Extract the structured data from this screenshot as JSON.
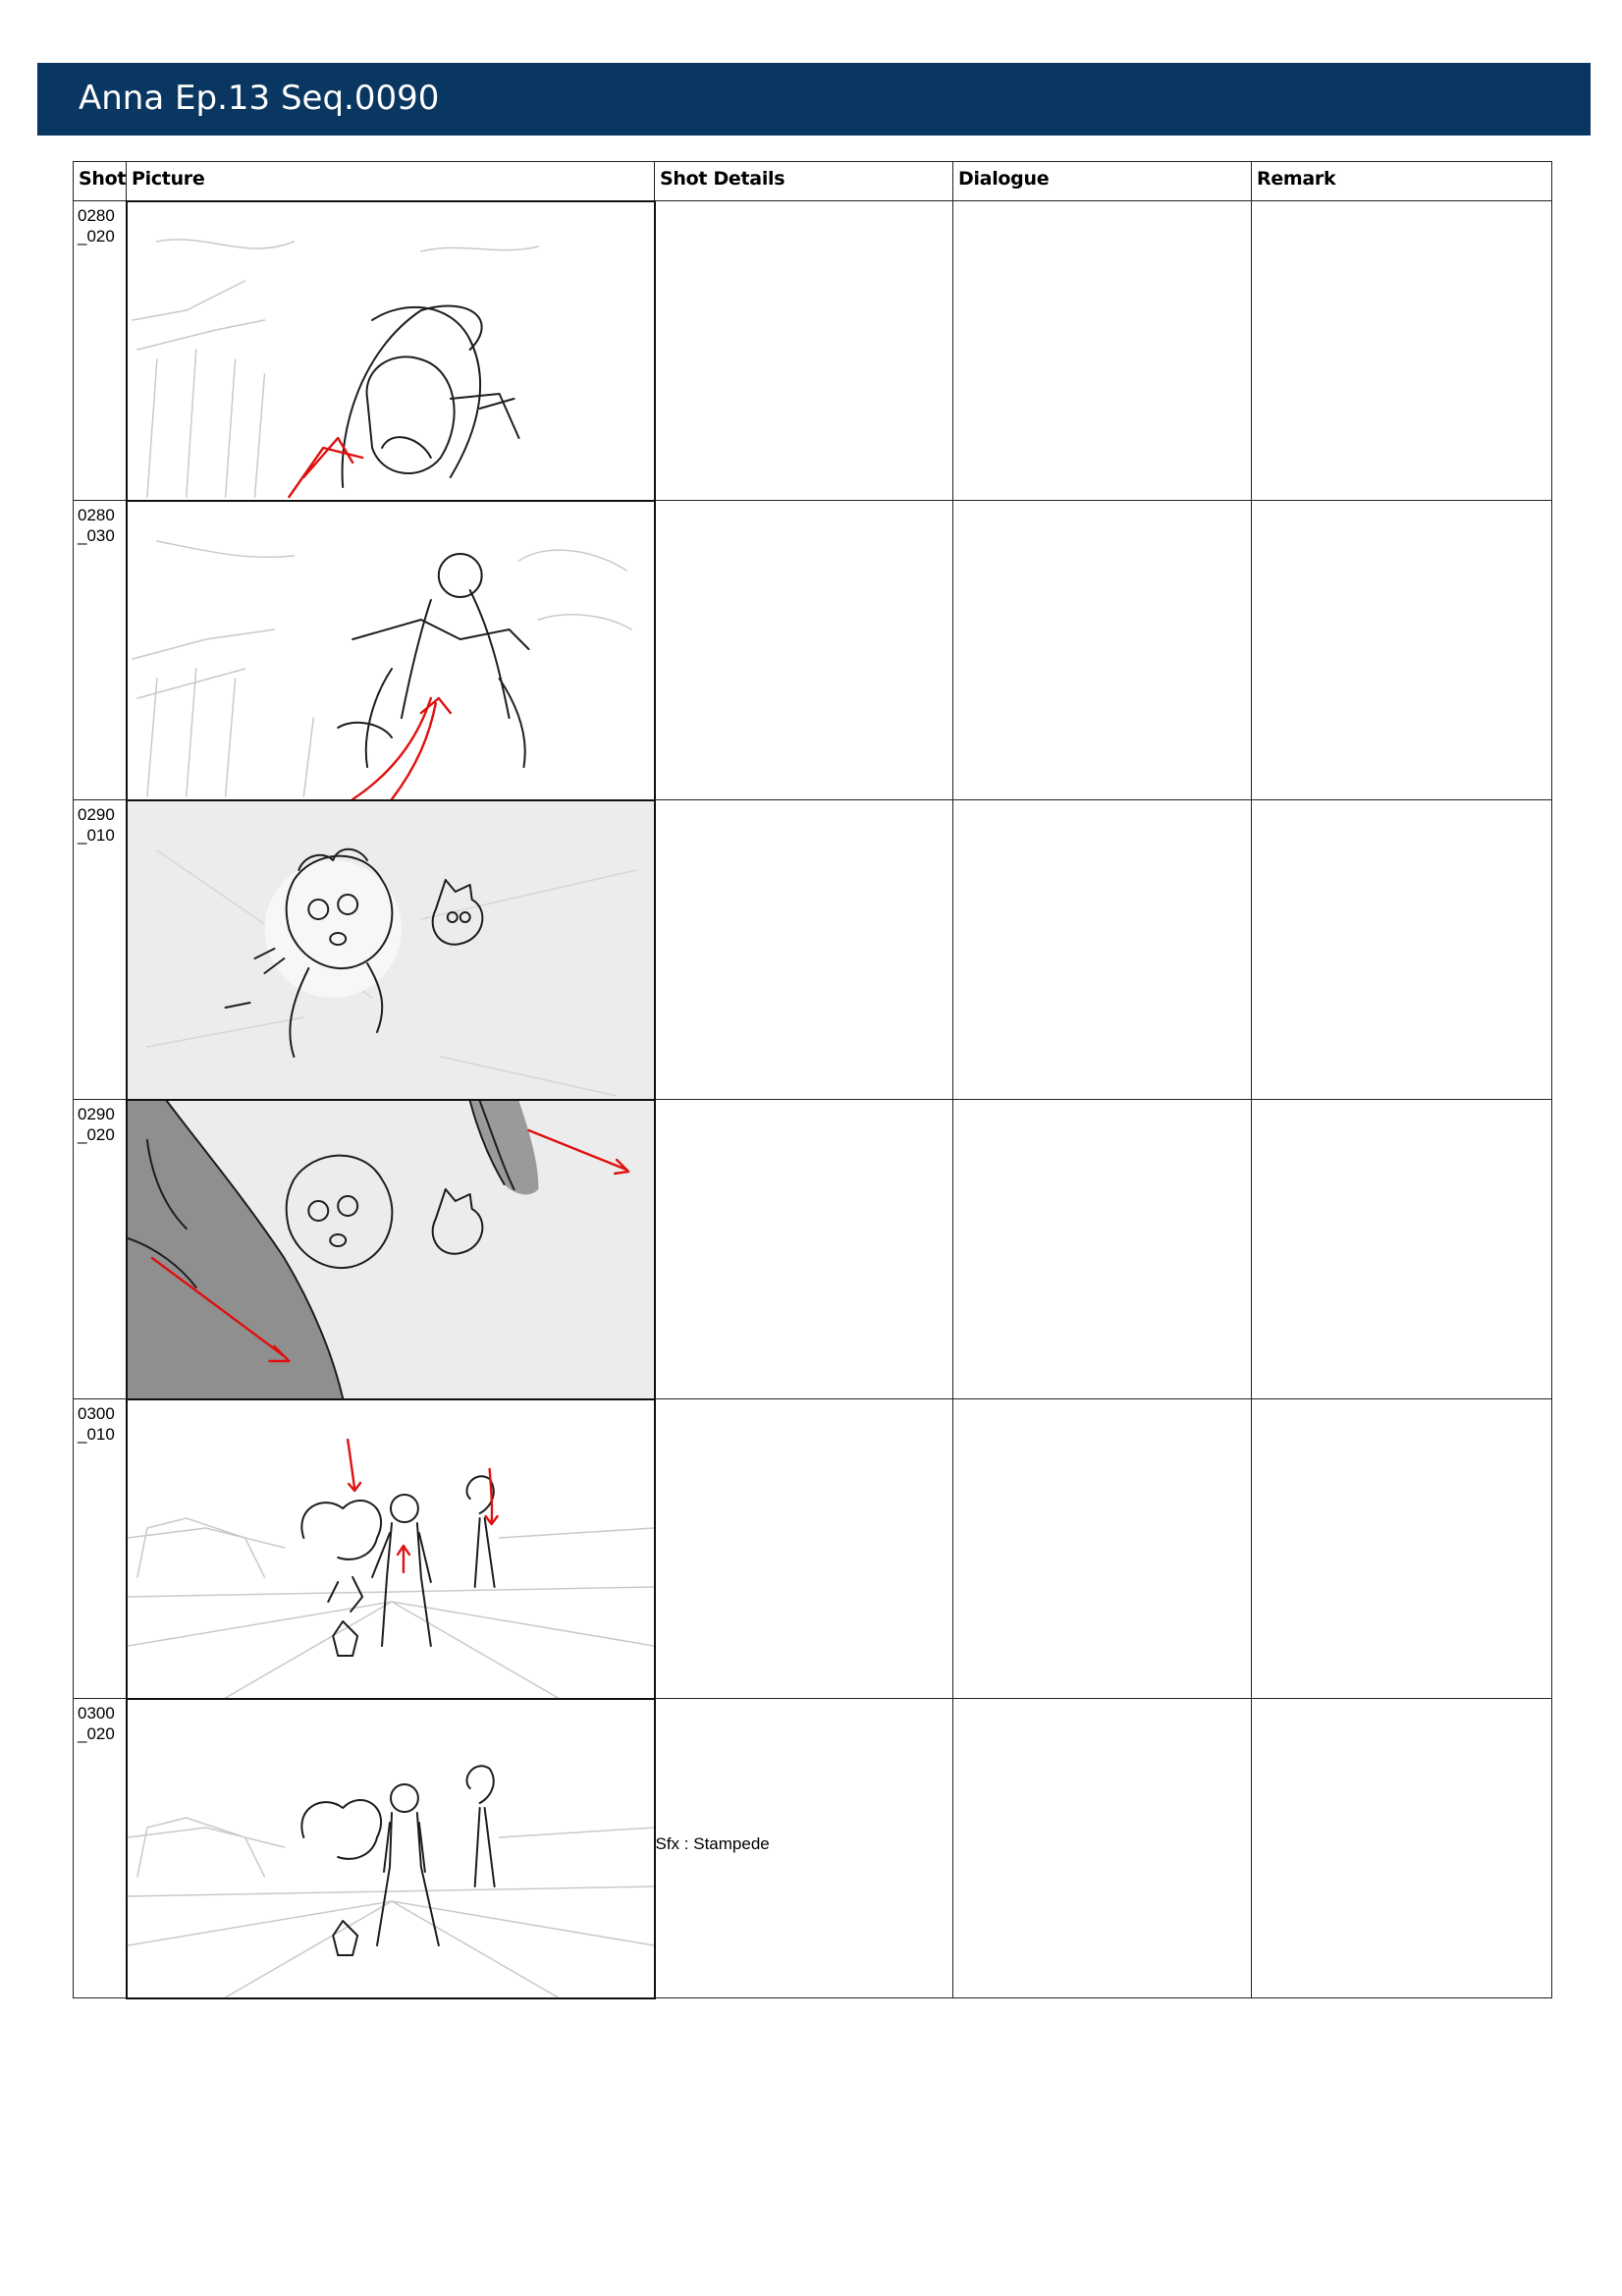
{
  "header": {
    "title": "Anna Ep.13 Seq.0090"
  },
  "columns": {
    "shot": "Shot",
    "picture": "Picture",
    "shot_details": "Shot Details",
    "dialogue": "Dialogue",
    "remark": "Remark"
  },
  "rows": [
    {
      "shot_line1": "0280",
      "shot_line2": "_020",
      "picture_icon": "storyboard-sketch-icon",
      "shot_details": "",
      "dialogue": "",
      "remark": ""
    },
    {
      "shot_line1": "0280",
      "shot_line2": "_030",
      "picture_icon": "storyboard-sketch-icon",
      "shot_details": "",
      "dialogue": "",
      "remark": ""
    },
    {
      "shot_line1": "0290",
      "shot_line2": "_010",
      "picture_icon": "storyboard-sketch-icon",
      "shot_details": "",
      "dialogue": "",
      "remark": ""
    },
    {
      "shot_line1": "0290",
      "shot_line2": "_020",
      "picture_icon": "storyboard-sketch-icon",
      "shot_details": "",
      "dialogue": "",
      "remark": ""
    },
    {
      "shot_line1": "0300",
      "shot_line2": "_010",
      "picture_icon": "storyboard-sketch-icon",
      "shot_details": "",
      "dialogue": "",
      "remark": ""
    },
    {
      "shot_line1": "0300",
      "shot_line2": "_020",
      "picture_icon": "storyboard-sketch-icon",
      "shot_details": "Sfx : Stampede",
      "dialogue": "",
      "remark": ""
    }
  ]
}
